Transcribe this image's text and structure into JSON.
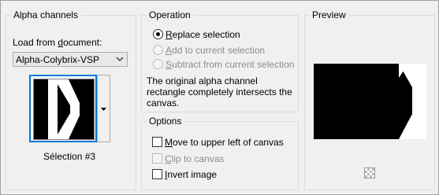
{
  "alpha": {
    "group_title": "Alpha channels",
    "load_label_prefix": "Load from ",
    "load_label_underlined": "d",
    "load_label_rest": "ocument:",
    "document_value": "Alpha-Colybrix-VSP",
    "selection_name": "Sélection #3"
  },
  "operation": {
    "group_title": "Operation",
    "options": [
      {
        "hot": "R",
        "rest": "eplace selection",
        "selected": true,
        "enabled": true
      },
      {
        "hot": "A",
        "rest": "dd to current selection",
        "selected": false,
        "enabled": false
      },
      {
        "hot": "S",
        "rest": "ubtract from current selection",
        "selected": false,
        "enabled": false
      }
    ],
    "description_line1": "The original alpha channel",
    "description_line2": "rectangle completely intersects the",
    "description_line3": "canvas."
  },
  "options": {
    "group_title": "Options",
    "checkboxes": [
      {
        "hot": "M",
        "rest": "ove to upper left of canvas",
        "checked": false,
        "enabled": true
      },
      {
        "hot": "C",
        "rest": "lip to canvas",
        "checked": false,
        "enabled": false
      },
      {
        "hot": "I",
        "rest": "nvert image",
        "checked": false,
        "enabled": true
      }
    ]
  },
  "preview": {
    "group_title": "Preview",
    "checker_icon": "transparency-checker-icon"
  },
  "colors": {
    "accent": "#0078d7",
    "disabled_text": "#8c8c8c",
    "background": "#f0f0f0"
  }
}
